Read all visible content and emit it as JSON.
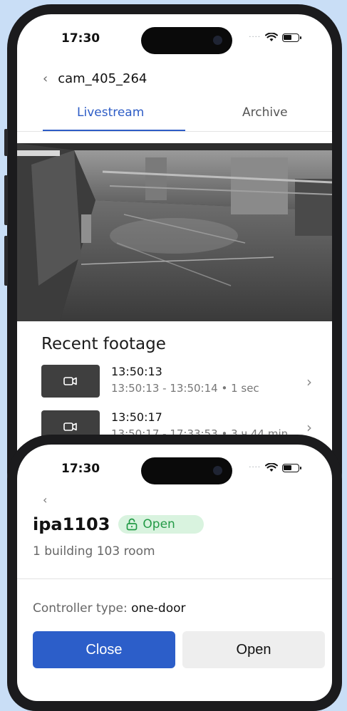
{
  "screen_livestream": {
    "status_time": "17:30",
    "camera_title": "cam_405_264",
    "tabs": {
      "livestream": "Livestream",
      "archive": "Archive"
    },
    "recent_title": "Recent footage",
    "footage": [
      {
        "time": "13:50:13",
        "range": "13:50:13 - 13:50:14 • 1 sec"
      },
      {
        "time": "13:50:17",
        "range": "13:50:17 - 17:33:53 • 3 ч 44 min"
      }
    ]
  },
  "screen_door": {
    "status_time": "17:30",
    "door_name": "ipa1103",
    "status_badge": "Open",
    "location": "1 building 103 room",
    "controller_label": "Controller type:",
    "controller_value": "one-door",
    "close_label": "Close",
    "open_label": "Open"
  },
  "colors": {
    "accent": "#2c5ec9",
    "badge_bg": "#d9f3df",
    "badge_text": "#239a46",
    "background": "#c9def6"
  },
  "icons": [
    "back-chevron-icon",
    "wifi-icon",
    "battery-icon",
    "video-camera-icon",
    "chevron-right-icon",
    "unlock-icon"
  ]
}
